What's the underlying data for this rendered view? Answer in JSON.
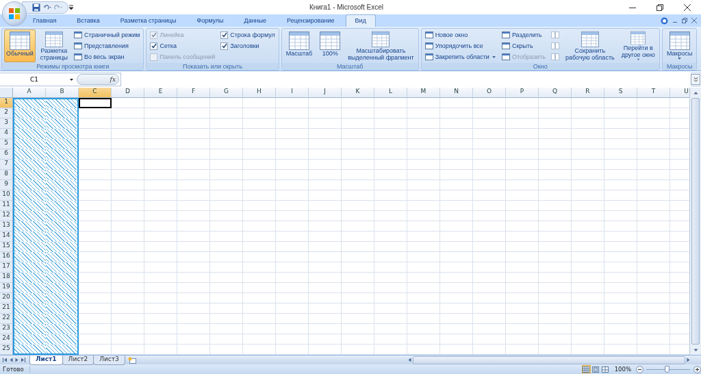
{
  "window": {
    "title": "Книга1 - Microsoft Excel"
  },
  "tabs": [
    {
      "label": "Главная",
      "selected": false
    },
    {
      "label": "Вставка",
      "selected": false
    },
    {
      "label": "Разметка страницы",
      "selected": false
    },
    {
      "label": "Формулы",
      "selected": false
    },
    {
      "label": "Данные",
      "selected": false
    },
    {
      "label": "Рецензирование",
      "selected": false
    },
    {
      "label": "Вид",
      "selected": true
    }
  ],
  "ribbon": {
    "groups": [
      {
        "label": "Режимы просмотра книги",
        "columns": [
          {
            "items": [
              {
                "kind": "large",
                "label": "Обычный",
                "selected": true
              }
            ]
          },
          {
            "items": [
              {
                "kind": "large",
                "label": "Разметка страницы",
                "selected": false
              }
            ]
          },
          {
            "items": [
              {
                "kind": "small",
                "label": "Страничный режим",
                "disabled": false
              },
              {
                "kind": "small",
                "label": "Представления",
                "disabled": false
              },
              {
                "kind": "small",
                "label": "Во весь экран",
                "disabled": false
              }
            ]
          }
        ]
      },
      {
        "label": "Показать или скрыть",
        "columns": [
          {
            "items": [
              {
                "kind": "check",
                "label": "Линейка",
                "checked": true,
                "disabled": true
              },
              {
                "kind": "check",
                "label": "Сетка",
                "checked": true,
                "disabled": false
              },
              {
                "kind": "check",
                "label": "Панель сообщений",
                "checked": false,
                "disabled": true
              }
            ]
          },
          {
            "items": [
              {
                "kind": "check",
                "label": "Строка формул",
                "checked": true,
                "disabled": false
              },
              {
                "kind": "check",
                "label": "Заголовки",
                "checked": true,
                "disabled": false
              }
            ]
          }
        ]
      },
      {
        "label": "Масштаб",
        "columns": [
          {
            "items": [
              {
                "kind": "large",
                "label": "Масштаб",
                "selected": false
              }
            ]
          },
          {
            "items": [
              {
                "kind": "large",
                "label": "100%",
                "selected": false
              }
            ]
          },
          {
            "items": [
              {
                "kind": "large",
                "label": "Масштабировать выделенный фрагмент",
                "selected": false
              }
            ]
          }
        ]
      },
      {
        "label": "Окно",
        "columns": [
          {
            "items": [
              {
                "kind": "small",
                "label": "Новое окно",
                "disabled": false
              },
              {
                "kind": "small",
                "label": "Упорядочить все",
                "disabled": false
              },
              {
                "kind": "small",
                "label": "Закрепить области",
                "disabled": false,
                "dropdown": true
              }
            ]
          },
          {
            "items": [
              {
                "kind": "small",
                "label": "Разделить",
                "disabled": false
              },
              {
                "kind": "small",
                "label": "Скрыть",
                "disabled": false
              },
              {
                "kind": "small",
                "label": "Отобразить",
                "disabled": true
              }
            ]
          },
          {
            "items": [
              {
                "kind": "icon",
                "disabled": true
              },
              {
                "kind": "icon",
                "disabled": true
              },
              {
                "kind": "icon",
                "disabled": true
              }
            ]
          },
          {
            "items": [
              {
                "kind": "large",
                "label": "Сохранить рабочую область",
                "selected": false
              }
            ]
          },
          {
            "items": [
              {
                "kind": "large",
                "label": "Перейти в другое окно",
                "selected": false,
                "dropdown": true
              }
            ]
          }
        ]
      },
      {
        "label": "Макросы",
        "columns": [
          {
            "items": [
              {
                "kind": "large",
                "label": "Макросы",
                "selected": false,
                "dropdown": true
              }
            ]
          }
        ]
      }
    ]
  },
  "formula_bar": {
    "name_box": "C1",
    "function_label": "fx"
  },
  "grid": {
    "columns": [
      {
        "label": "A",
        "selected": false,
        "hatched": true
      },
      {
        "label": "B",
        "selected": false,
        "hatched": true
      },
      {
        "label": "C",
        "selected": true,
        "hatched": false
      },
      {
        "label": "D",
        "selected": false,
        "hatched": false
      },
      {
        "label": "E",
        "selected": false,
        "hatched": false
      },
      {
        "label": "F",
        "selected": false,
        "hatched": false
      },
      {
        "label": "G",
        "selected": false,
        "hatched": false
      },
      {
        "label": "H",
        "selected": false,
        "hatched": false
      },
      {
        "label": "I",
        "selected": false,
        "hatched": false
      },
      {
        "label": "J",
        "selected": false,
        "hatched": false
      },
      {
        "label": "K",
        "selected": false,
        "hatched": false
      },
      {
        "label": "L",
        "selected": false,
        "hatched": false
      },
      {
        "label": "M",
        "selected": false,
        "hatched": false
      },
      {
        "label": "N",
        "selected": false,
        "hatched": false
      },
      {
        "label": "O",
        "selected": false,
        "hatched": false
      },
      {
        "label": "P",
        "selected": false,
        "hatched": false
      },
      {
        "label": "Q",
        "selected": false,
        "hatched": false
      },
      {
        "label": "R",
        "selected": false,
        "hatched": false
      },
      {
        "label": "S",
        "selected": false,
        "hatched": false
      },
      {
        "label": "T",
        "selected": false,
        "hatched": false
      },
      {
        "label": "U",
        "selected": false,
        "hatched": false
      }
    ],
    "rows": [
      {
        "label": "1",
        "selected": true,
        "hatched": true
      },
      {
        "label": "2",
        "selected": false,
        "hatched": true
      },
      {
        "label": "3",
        "selected": false,
        "hatched": true
      },
      {
        "label": "4",
        "selected": false,
        "hatched": true
      },
      {
        "label": "5",
        "selected": false,
        "hatched": true
      },
      {
        "label": "6",
        "selected": false,
        "hatched": true
      },
      {
        "label": "7",
        "selected": false,
        "hatched": true
      },
      {
        "label": "8",
        "selected": false,
        "hatched": true
      },
      {
        "label": "9",
        "selected": false,
        "hatched": true
      },
      {
        "label": "10",
        "selected": false,
        "hatched": true
      },
      {
        "label": "11",
        "selected": false,
        "hatched": true
      },
      {
        "label": "12",
        "selected": false,
        "hatched": true
      },
      {
        "label": "13",
        "selected": false,
        "hatched": true
      },
      {
        "label": "14",
        "selected": false,
        "hatched": true
      },
      {
        "label": "15",
        "selected": false,
        "hatched": true
      },
      {
        "label": "16",
        "selected": false,
        "hatched": true
      },
      {
        "label": "17",
        "selected": false,
        "hatched": true
      },
      {
        "label": "18",
        "selected": false,
        "hatched": true
      },
      {
        "label": "19",
        "selected": false,
        "hatched": true
      },
      {
        "label": "20",
        "selected": false,
        "hatched": true
      },
      {
        "label": "21",
        "selected": false,
        "hatched": true
      },
      {
        "label": "22",
        "selected": false,
        "hatched": true
      },
      {
        "label": "23",
        "selected": false,
        "hatched": true
      },
      {
        "label": "24",
        "selected": false,
        "hatched": true
      },
      {
        "label": "25",
        "selected": false,
        "hatched": true
      }
    ]
  },
  "sheet_tabs": [
    {
      "label": "Лист1",
      "selected": true
    },
    {
      "label": "Лист2",
      "selected": false
    },
    {
      "label": "Лист3",
      "selected": false
    }
  ],
  "status_bar": {
    "text": "Готово",
    "views": [
      {
        "selected": true
      },
      {
        "selected": false
      },
      {
        "selected": false
      }
    ],
    "zoom": "100%",
    "zoom_slider": {
      "level": 0.47
    }
  }
}
